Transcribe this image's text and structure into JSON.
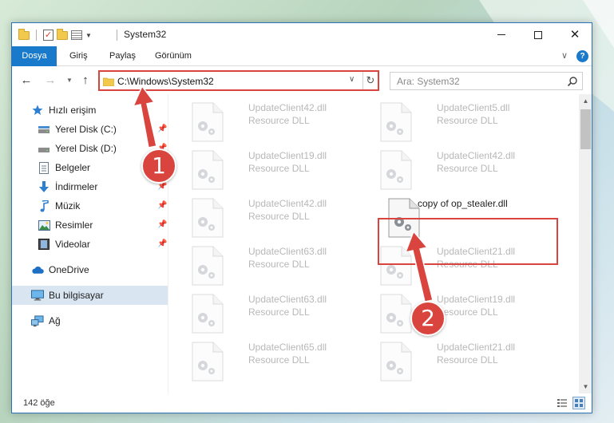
{
  "window": {
    "title": "System32",
    "accent_color": "#1979ca",
    "highlight_color": "#d9443f"
  },
  "ribbon": {
    "tabs": [
      "Dosya",
      "Giriş",
      "Paylaş",
      "Görünüm"
    ]
  },
  "address": {
    "path": "C:\\Windows\\System32",
    "search_placeholder": "Ara: System32"
  },
  "sidebar": {
    "items": [
      {
        "label": "Hızlı erişim",
        "icon": "star-icon"
      },
      {
        "label": "Yerel Disk (C:)",
        "icon": "drive-icon"
      },
      {
        "label": "Yerel Disk (D:)",
        "icon": "drive-icon"
      },
      {
        "label": "Belgeler",
        "icon": "documents-icon"
      },
      {
        "label": "İndirmeler",
        "icon": "download-icon"
      },
      {
        "label": "Müzik",
        "icon": "music-icon"
      },
      {
        "label": "Resimler",
        "icon": "pictures-icon"
      },
      {
        "label": "Videolar",
        "icon": "videos-icon"
      },
      {
        "label": "OneDrive",
        "icon": "cloud-icon"
      },
      {
        "label": "Bu bilgisayar",
        "icon": "computer-icon"
      },
      {
        "label": "Ağ",
        "icon": "network-icon"
      }
    ]
  },
  "files": [
    {
      "name": "UpdateClient42.dll",
      "type": "Resource DLL"
    },
    {
      "name": "UpdateClient5.dll",
      "type": "Resource DLL"
    },
    {
      "name": "UpdateClient19.dll",
      "type": "Resource DLL"
    },
    {
      "name": "UpdateClient42.dll",
      "type": "Resource DLL"
    },
    {
      "name": "UpdateClient42.dll",
      "type": "Resource DLL"
    },
    {
      "name": "copy of op_stealer.dll",
      "type": ""
    },
    {
      "name": "UpdateClient63.dll",
      "type": "Resource DLL"
    },
    {
      "name": "UpdateClient21.dll",
      "type": "Resource DLL"
    },
    {
      "name": "UpdateClient63.dll",
      "type": "Resource DLL"
    },
    {
      "name": "UpdateClient19.dll",
      "type": "Resource DLL"
    },
    {
      "name": "UpdateClient65.dll",
      "type": "Resource DLL"
    },
    {
      "name": "UpdateClient21.dll",
      "type": "Resource DLL"
    }
  ],
  "status": {
    "item_count": "142 öğe"
  },
  "callouts": [
    "1",
    "2"
  ]
}
